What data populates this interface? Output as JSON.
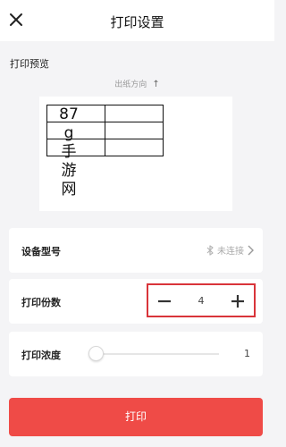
{
  "header": {
    "title": "打印设置",
    "close_icon": "close-icon"
  },
  "preview": {
    "section_label": "打印预览",
    "direction_label": "出纸方向",
    "direction_icon": "arrow-up-icon",
    "label_text": [
      "87",
      "g",
      "手",
      "游",
      "网"
    ]
  },
  "device": {
    "label": "设备型号",
    "status": "未连接",
    "status_icon": "bluetooth-icon"
  },
  "copies": {
    "label": "打印份数",
    "value": "4"
  },
  "density": {
    "label": "打印浓度",
    "value": "1"
  },
  "actions": {
    "print_label": "打印"
  },
  "colors": {
    "accent": "#ef4b47",
    "highlight_border": "#d9343a",
    "background": "#f4f4f6"
  }
}
